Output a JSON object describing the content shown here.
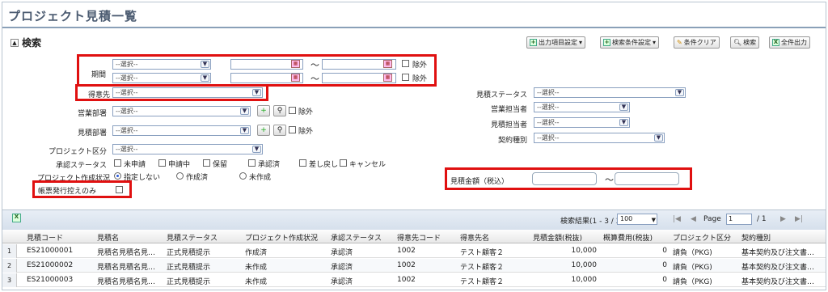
{
  "page": {
    "title": "プロジェクト見積一覧"
  },
  "search": {
    "section_title": "検索",
    "toolbar": {
      "output_settings": "出力項目設定",
      "condition_settings": "検索条件設定",
      "clear": "条件クリア",
      "search": "検索",
      "export_all": "全件出力"
    },
    "period": {
      "label": "期間",
      "select1": "--選択--",
      "select2": "--選択--",
      "tilde": "〜",
      "exclude": "除外"
    },
    "client": {
      "label": "得意先",
      "value": "--選択--"
    },
    "sales_dept": {
      "label": "営業部署",
      "value": "--選択--",
      "exclude": "除外"
    },
    "estimate_dept": {
      "label": "見積部署",
      "value": "--選択--",
      "exclude": "除外"
    },
    "project_type": {
      "label": "プロジェクト区分",
      "value": "--選択--"
    },
    "approval_status": {
      "label": "承認ステータス",
      "options": [
        "未申請",
        "申請中",
        "保留",
        "承認済",
        "差し戻し",
        "キャンセル"
      ]
    },
    "creation_status": {
      "label": "プロジェクト作成状況",
      "options": [
        "指定しない",
        "作成済",
        "未作成"
      ]
    },
    "invoice_only": {
      "label": "帳票発行控えのみ"
    },
    "estimate_status": {
      "label": "見積ステータス",
      "value": "--選択--"
    },
    "sales_person": {
      "label": "営業担当者",
      "value": "--選択--"
    },
    "estimate_person": {
      "label": "見積担当者",
      "value": "--選択--"
    },
    "contract_type": {
      "label": "契約種別",
      "value": "--選択--"
    },
    "amount": {
      "label": "見積金額（税込）",
      "tilde": "〜"
    }
  },
  "grid": {
    "result_text": "検索結果(1 - 3 / 3)",
    "page_size": "100",
    "page_label": "Page",
    "page_value": "1",
    "page_total": "/ 1",
    "columns": [
      "見積コード",
      "見積名",
      "見積ステータス",
      "プロジェクト作成状況",
      "承認ステータス",
      "得意先コード",
      "得意先名",
      "見積金額(税抜)",
      "概算費用(税抜)",
      "プロジェクト区分",
      "契約種別"
    ],
    "rows": [
      {
        "num": "1",
        "code": "ES21000001",
        "name": "見積名見積名見…",
        "est_status": "正式見積提示",
        "create_status": "作成済",
        "approval": "承認済",
        "client_code": "1002",
        "client_name": "テスト顧客２",
        "amount": "10,000",
        "cost": "0",
        "proj_type": "請負（PKG)",
        "contract": "基本契約及び注文書…"
      },
      {
        "num": "2",
        "code": "ES21000002",
        "name": "見積名見積名見…",
        "est_status": "正式見積提示",
        "create_status": "未作成",
        "approval": "承認済",
        "client_code": "1002",
        "client_name": "テスト顧客２",
        "amount": "10,000",
        "cost": "0",
        "proj_type": "請負（PKG)",
        "contract": "基本契約及び注文書…"
      },
      {
        "num": "3",
        "code": "ES21000003",
        "name": "見積名見積名見…",
        "est_status": "正式見積提示",
        "create_status": "未作成",
        "approval": "承認済",
        "client_code": "1002",
        "client_name": "テスト顧客２",
        "amount": "10,000",
        "cost": "0",
        "proj_type": "請負（PKG)",
        "contract": "基本契約及び注文書…"
      }
    ]
  }
}
